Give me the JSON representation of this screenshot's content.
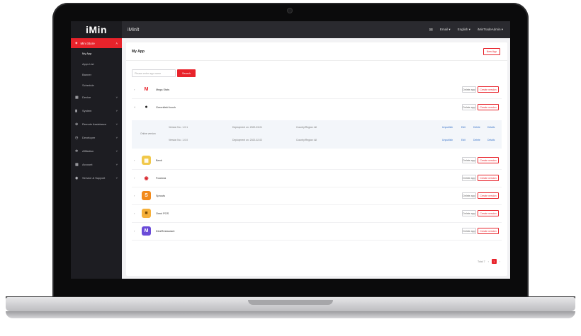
{
  "topbar": {
    "logo": "iMin",
    "app_title": "iMinlt",
    "items": [
      "Email",
      "English",
      "iMinTradeAdmin"
    ]
  },
  "sidebar": {
    "active": "Mini Store",
    "sub_items": [
      "My App",
      "Apps List",
      "Banner",
      "Schedule"
    ],
    "menu": [
      {
        "label": "Device",
        "icon": "grid-icon"
      },
      {
        "label": "System",
        "icon": "document-icon"
      },
      {
        "label": "Remote Assistance",
        "icon": "globe-icon"
      },
      {
        "label": "Developer",
        "icon": "clock-icon"
      },
      {
        "label": "Affiliation",
        "icon": "settings-icon"
      },
      {
        "label": "Account",
        "icon": "folder-icon"
      },
      {
        "label": "Service & Support",
        "icon": "user-icon"
      }
    ]
  },
  "main": {
    "title": "My App",
    "new_app": "New App",
    "search_placeholder": "Please enter app name",
    "search_button": "Search",
    "delete_app": "Delete app",
    "create_version": "Create version",
    "apps": [
      {
        "name": "Mega Stats",
        "icon": "M",
        "color": "#ffffff"
      },
      {
        "name": "Greenfield touch",
        "icon": "●",
        "color": "#ffffff"
      },
      {
        "name": "Bank",
        "icon": "▦",
        "color": "#f1c84a"
      },
      {
        "name": "Foodora",
        "icon": "◉",
        "color": "#ffffff"
      },
      {
        "name": "Sprouts",
        "icon": "S",
        "color": "#f28a1c"
      },
      {
        "name": "Omni POS",
        "icon": "■",
        "color": "#f6b03a"
      },
      {
        "name": "DineRestaurant",
        "icon": "M",
        "color": "#6a4bd8"
      }
    ],
    "versions": {
      "label": "Online version",
      "rows": [
        {
          "version": "Version No.: 1.0.1",
          "deployment": "Deployment on: 2022-03-01",
          "region": "Country/Region: All",
          "links": [
            "Unpublish",
            "Edit",
            "Delete",
            "Details"
          ]
        },
        {
          "version": "Version No.: 1.0.0",
          "deployment": "Deployment on: 2022-02-02",
          "region": "Country/Region: All",
          "links": [
            "Unpublish",
            "Edit",
            "Delete",
            "Details"
          ]
        }
      ]
    },
    "pager": {
      "total": "Total 7",
      "current": "1"
    }
  }
}
